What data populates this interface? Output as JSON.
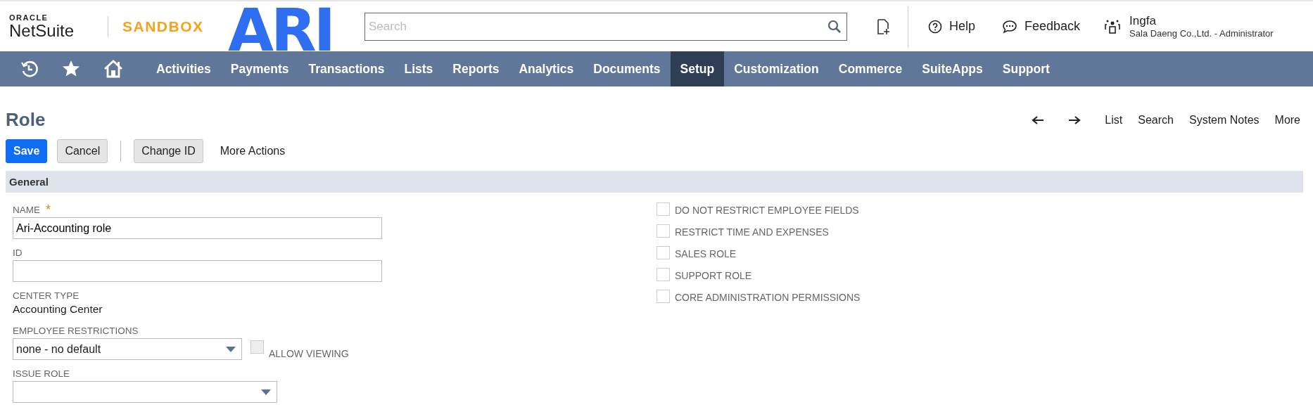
{
  "header": {
    "brand_top": "ORACLE",
    "brand": "NetSuite",
    "environment": "SANDBOX",
    "company_logo": "ARI",
    "search": {
      "placeholder": "Search"
    },
    "help": "Help",
    "feedback": "Feedback",
    "user": {
      "name": "Ingfa",
      "account": "Sala Daeng Co.,Ltd. - Administrator"
    }
  },
  "nav": {
    "items": [
      {
        "label": "Activities",
        "selected": false
      },
      {
        "label": "Payments",
        "selected": false
      },
      {
        "label": "Transactions",
        "selected": false
      },
      {
        "label": "Lists",
        "selected": false
      },
      {
        "label": "Reports",
        "selected": false
      },
      {
        "label": "Analytics",
        "selected": false
      },
      {
        "label": "Documents",
        "selected": false
      },
      {
        "label": "Setup",
        "selected": true
      },
      {
        "label": "Customization",
        "selected": false
      },
      {
        "label": "Commerce",
        "selected": false
      },
      {
        "label": "SuiteApps",
        "selected": false
      },
      {
        "label": "Support",
        "selected": false
      }
    ]
  },
  "page": {
    "title": "Role",
    "links": [
      "List",
      "Search",
      "System Notes",
      "More"
    ],
    "buttons": [
      {
        "label": "Save",
        "kind": "primary"
      },
      {
        "label": "Cancel",
        "kind": "secondary"
      },
      {
        "label": "Change ID",
        "kind": "secondary"
      },
      {
        "label": "More Actions",
        "kind": "plain"
      }
    ]
  },
  "section": {
    "title": "General",
    "fields": [
      {
        "kind": "text",
        "label": "NAME",
        "required_mark": "*",
        "value": "Ari-Accounting role"
      },
      {
        "kind": "text",
        "label": "ID"
      },
      {
        "kind": "static",
        "label": "CENTER TYPE",
        "value": "Accounting Center"
      },
      {
        "kind": "select",
        "label": "EMPLOYEE RESTRICTIONS",
        "value": "none - no default",
        "checkbox": {
          "label": "ALLOW VIEWING",
          "checked": false,
          "disabled": true
        }
      },
      {
        "kind": "select",
        "label": "ISSUE ROLE"
      }
    ],
    "checkboxes": [
      {
        "label": "DO NOT RESTRICT EMPLOYEE FIELDS",
        "checked": false
      },
      {
        "label": "RESTRICT TIME AND EXPENSES",
        "checked": false
      },
      {
        "label": "SALES ROLE",
        "checked": false
      },
      {
        "label": "SUPPORT ROLE",
        "checked": false
      },
      {
        "label": "CORE ADMINISTRATION PERMISSIONS",
        "checked": false
      }
    ]
  }
}
